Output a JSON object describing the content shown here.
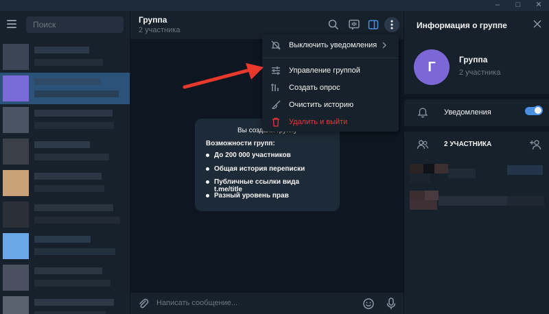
{
  "window": {
    "minimize": "–",
    "maximize": "□",
    "close": "✕"
  },
  "sidebar": {
    "search_placeholder": "Поиск"
  },
  "chat": {
    "title": "Группа",
    "subtitle": "2 участника",
    "card": {
      "heading": "Вы создали группу",
      "capabilities_title": "Возможности групп:",
      "items": [
        "До 200 000 участников",
        "Общая история переписки",
        "Публичные ссылки вида t.me/title",
        "Разный уровень прав"
      ]
    },
    "composer_placeholder": "Написать сообщение..."
  },
  "menu": {
    "items": [
      {
        "label": "Выключить уведомления",
        "icon": "bell-off-icon"
      },
      {
        "label": "Управление группой",
        "icon": "sliders-icon"
      },
      {
        "label": "Создать опрос",
        "icon": "poll-icon"
      },
      {
        "label": "Очистить историю",
        "icon": "broom-icon"
      },
      {
        "label": "Удалить и выйти",
        "icon": "trash-icon",
        "color": "#e53935"
      }
    ]
  },
  "info_panel": {
    "title": "Информация о группе",
    "avatar_letter": "Г",
    "avatar_color": "#7b68d6",
    "group_name": "Группа",
    "member_count": "2 участника",
    "notifications_label": "Уведомления",
    "notifications_on": true,
    "members_header": "2 УЧАСТНИКА"
  },
  "colors": {
    "accent": "#4a90e2",
    "danger": "#e53935",
    "arrow": "#e8392c"
  }
}
